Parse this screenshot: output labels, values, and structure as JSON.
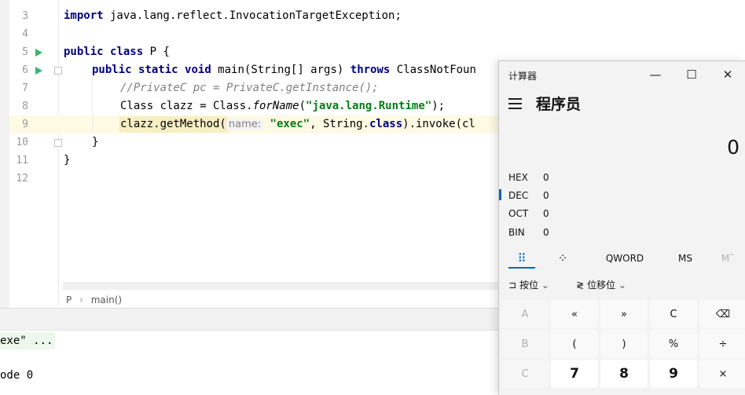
{
  "editor": {
    "line_numbers": [
      "3",
      "4",
      "5",
      "6",
      "7",
      "8",
      "9",
      "10",
      "11",
      "12"
    ],
    "lines": {
      "l3": {
        "kw": "import",
        "rest": " java.lang.reflect.InvocationTargetException;"
      },
      "l5": {
        "kw1": "public",
        "kw2": "class",
        "rest": " P {"
      },
      "l6": {
        "kw1": "public",
        "kw2": "static",
        "kw3": "void",
        "mid": " main(String[] args) ",
        "kw4": "throws",
        "rest": " ClassNotFoun"
      },
      "l7": {
        "comment_a": "//PrivateC pc = PrivateC.",
        "comment_b": "getInstance",
        "comment_c": "();"
      },
      "l8": {
        "a": "Class clazz = Class.",
        "method": "forName",
        "b": "(",
        "str": "\"java.lang.Runtime\"",
        "c": ");"
      },
      "l9": {
        "a": "clazz.getMethod(",
        "hint": "name:",
        "str": "\"exec\"",
        "b": ", String.",
        "kw": "class",
        "c": ").invoke(cl"
      },
      "l10": {
        "text": "}"
      },
      "l11": {
        "text": "}"
      }
    }
  },
  "breadcrumb": {
    "class_name": "P",
    "separator": "›",
    "method": "main()"
  },
  "console": {
    "line1": "exe\" ...",
    "line2": "ode 0"
  },
  "calculator": {
    "window_title": "计算器",
    "minimize_icon": "—",
    "maximize_icon": "☐",
    "close_icon": "✕",
    "mode": "程序员",
    "display_value": "0",
    "bases": [
      {
        "label": "HEX",
        "value": "0"
      },
      {
        "label": "DEC",
        "value": "0"
      },
      {
        "label": "OCT",
        "value": "0"
      },
      {
        "label": "BIN",
        "value": "0"
      }
    ],
    "tabs": {
      "keypad_icon": "⠿",
      "bitflip_icon": "⁘",
      "word": "QWORD",
      "ms": "MS",
      "mplus": "M˜"
    },
    "bitwise": {
      "label": "按位",
      "chev": "⌄",
      "shift": "位移位",
      "shift_chev": "⌄"
    },
    "keys": [
      [
        "A",
        "«",
        "»",
        "C",
        "⌫"
      ],
      [
        "B",
        "(",
        ")",
        "%",
        "÷"
      ],
      [
        "C",
        "7",
        "8",
        "9",
        "×"
      ]
    ],
    "accent_color": "#0067c0"
  }
}
